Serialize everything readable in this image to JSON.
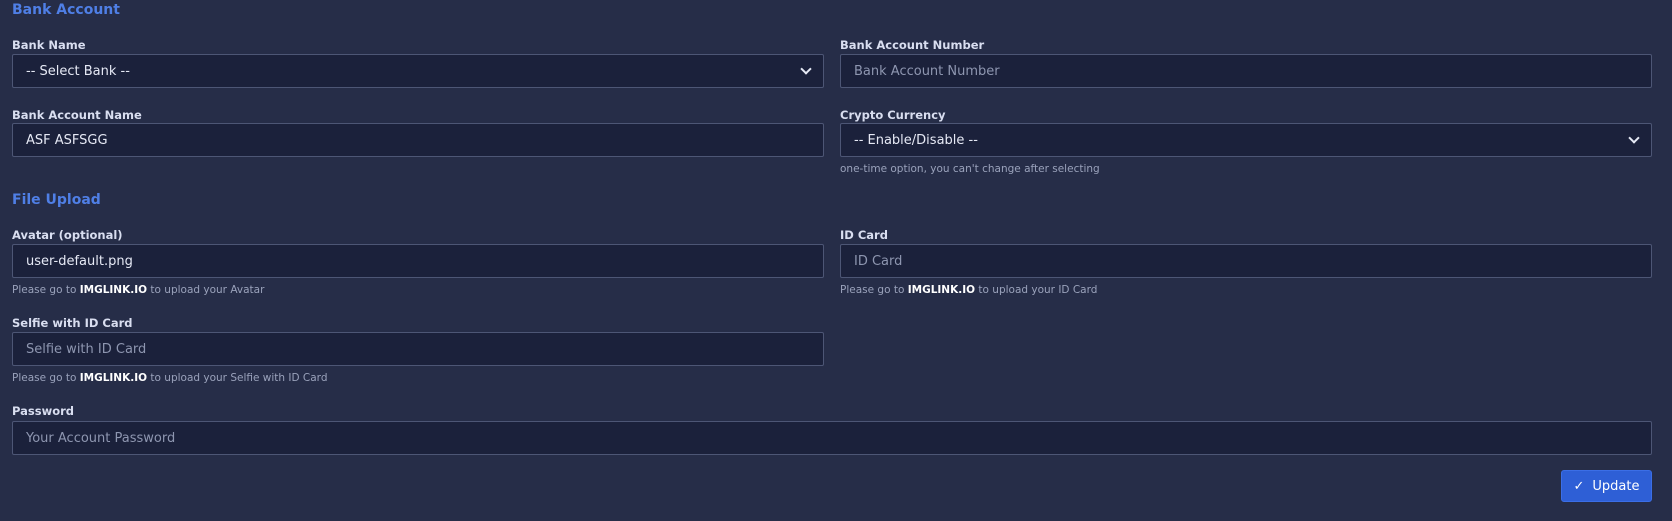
{
  "bank_section": {
    "title": "Bank Account",
    "bank_name": {
      "label": "Bank Name",
      "selected": "-- Select Bank --"
    },
    "account_number": {
      "label": "Bank Account Number",
      "placeholder": "Bank Account Number",
      "value": ""
    },
    "account_name": {
      "label": "Bank Account Name",
      "value": "ASF ASFSGG"
    },
    "crypto": {
      "label": "Crypto Currency",
      "selected": "-- Enable/Disable --",
      "help": "one-time option, you can't change after selecting"
    }
  },
  "file_section": {
    "title": "File Upload",
    "avatar": {
      "label": "Avatar (optional)",
      "value": "user-default.png",
      "help_prefix": "Please go to",
      "help_link": "IMGLINK.IO",
      "help_suffix": "to upload your Avatar"
    },
    "id_card": {
      "label": "ID Card",
      "placeholder": "ID Card",
      "help_prefix": "Please go to",
      "help_link": "IMGLINK.IO",
      "help_suffix": "to upload your ID Card"
    },
    "selfie": {
      "label": "Selfie with ID Card",
      "placeholder": "Selfie with ID Card",
      "help_prefix": "Please go to",
      "help_link": "IMGLINK.IO",
      "help_suffix": "to upload your Selfie with ID Card"
    }
  },
  "password": {
    "label": "Password",
    "placeholder": "Your Account Password"
  },
  "update_button": {
    "label": "Update",
    "icon": "check-icon"
  },
  "colors": {
    "background": "#262d48",
    "accent": "#4f7fe6",
    "button": "#2e5fd6"
  }
}
